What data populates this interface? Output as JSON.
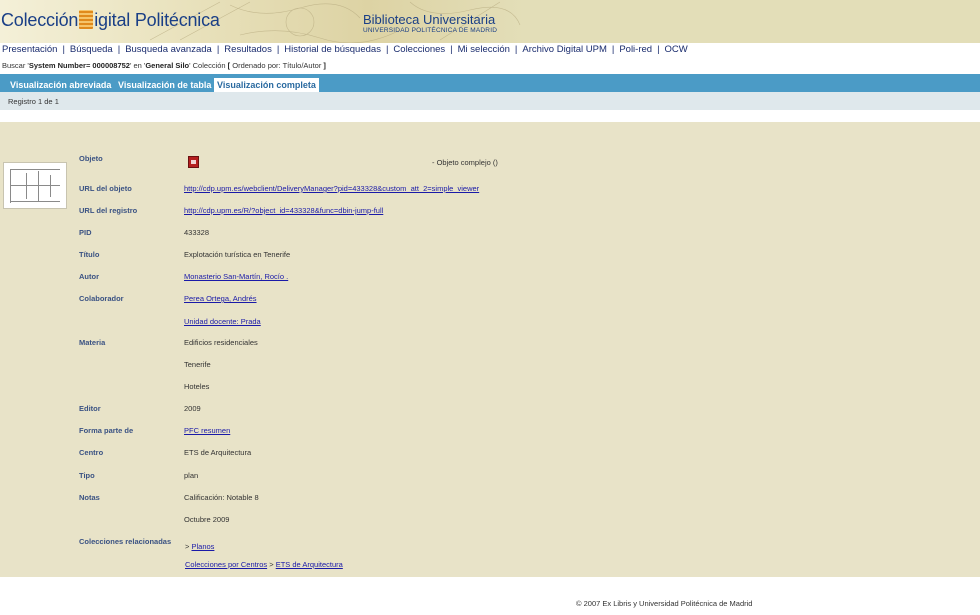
{
  "header": {
    "logo_left": "Colección",
    "logo_right": "igital Politécnica",
    "library_title": "Biblioteca Universitaria",
    "library_subtitle": "UNIVERSIDAD POLITÉCNICA DE MADRID"
  },
  "nav": {
    "items": [
      "Presentación",
      "Búsqueda",
      "Busqueda avanzada",
      "Resultados",
      "Historial de búsquedas",
      "Colecciones",
      "Mi selección",
      "Archivo Digital UPM",
      "Poli-red",
      "OCW"
    ]
  },
  "search": {
    "prefix": "Buscar '",
    "query": "System Number= 000008752",
    "mid": "' en '",
    "base": "General Silo",
    "suffix": "' Colección",
    "bracket_open": " [ ",
    "order": "Ordenado por: Título/Autor",
    "bracket_close": " ]"
  },
  "tabs": [
    "Visualización abreviada",
    "Visualización de tabla",
    "Visualización completa"
  ],
  "record_count": "Registro 1 de 1",
  "record": {
    "objeto_label": "Objeto",
    "objeto_value": "- Objeto complejo ()",
    "url_objeto_label": "URL del objeto",
    "url_objeto_value": "http://cdp.upm.es/webclient/DeliveryManager?pid=433328&custom_att_2=simple_viewer",
    "url_registro_label": "URL del registro",
    "url_registro_value": "http://cdp.upm.es/R/?object_id=433328&func=dbin-jump-full",
    "pid_label": "PID",
    "pid_value": "433328",
    "titulo_label": "Título",
    "titulo_value": "Explotación turística en Tenerife",
    "autor_label": "Autor",
    "autor_value": "Monasterio San-Martín, Rocío .",
    "colaborador_label": "Colaborador",
    "colaborador_value_1": "Perea Ortega, Andrés",
    "colaborador_value_2": "Unidad docente: Prada",
    "materia_label": "Materia",
    "materia_value_1": "Edificios residenciales",
    "materia_value_2": "Tenerife",
    "materia_value_3": "Hoteles",
    "editor_label": "Editor",
    "editor_value": "2009",
    "forma_parte_label": "Forma parte de",
    "forma_parte_value": "PFC resumen",
    "centro_label": "Centro",
    "centro_value": "ETS de Arquitectura",
    "tipo_label": "Tipo",
    "tipo_value": "plan",
    "notas_label": "Notas",
    "notas_value_1": "Calificación: Notable 8",
    "notas_value_2": "Octubre 2009",
    "colecciones_label": "Colecciones relacionadas",
    "coll_arrow_1": ">",
    "coll_planos": "Planos",
    "coll_por_centros": "Colecciones por Centros",
    "coll_arrow_2": ">",
    "coll_ets": "ETS de Arquitectura"
  },
  "footer": "© 2007 Ex Libris y Universidad Politécnica de Madrid",
  "colors": {
    "banner": "#e3deb8",
    "tabs_bar": "#4b9bc6",
    "content_bg": "#e8e3c8",
    "label": "#3a5283",
    "link": "#1a1aa8"
  }
}
